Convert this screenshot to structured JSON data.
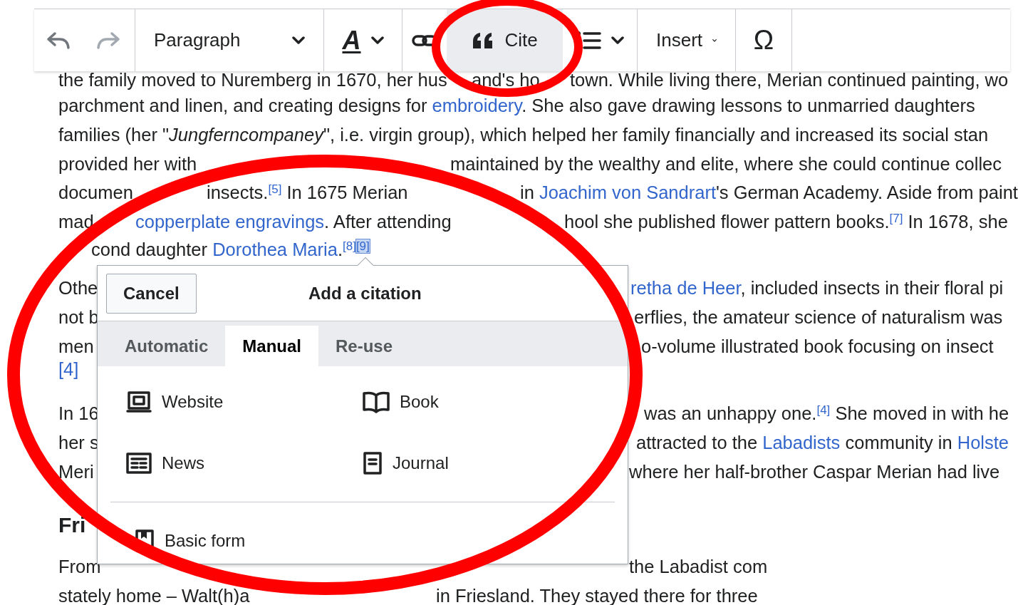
{
  "toolbar": {
    "items": [
      {
        "kind": "undo",
        "disabled": false,
        "highlighted": false
      },
      {
        "kind": "redo",
        "disabled": true,
        "highlighted": false
      },
      {
        "kind": "dropdown",
        "label": "Paragraph",
        "highlighted": false
      },
      {
        "kind": "text_style",
        "label": "A",
        "highlighted": false
      },
      {
        "kind": "link",
        "highlighted": false
      },
      {
        "kind": "cite",
        "label": "Cite",
        "highlighted": true
      },
      {
        "kind": "list",
        "highlighted": false
      },
      {
        "kind": "dropdown",
        "label": "Insert",
        "highlighted": false
      },
      {
        "kind": "char",
        "label": "Ω",
        "highlighted": false
      }
    ]
  },
  "article": {
    "lines": [
      {
        "pieces": [
          [
            {
              "kind": "text",
              "text": "the family moved to Nuremberg in 1670, her hus"
            }
          ],
          [
            {
              "kind": "text",
              "text": "and's ho"
            }
          ],
          [
            {
              "kind": "text",
              "text": "town. While living there, Merian continued painting, wo"
            }
          ]
        ]
      },
      {
        "pieces": [
          [
            {
              "kind": "text",
              "text": "parchment and linen, and creating designs for "
            },
            {
              "kind": "link",
              "text": "embroidery"
            },
            {
              "kind": "text",
              "text": ". She also gave drawing lessons to unmarried daughters"
            }
          ]
        ]
      },
      {
        "pieces": [
          [
            {
              "kind": "text",
              "text": "families (her \"*Jungferncompaney*\", i.e. virgin group), which helped her family financially and increased its social stan"
            }
          ]
        ]
      },
      {
        "pieces": [
          [
            {
              "kind": "text",
              "text": "provided her with"
            }
          ],
          [
            {
              "kind": "text",
              "text": "maintained by the wealthy and elite, where she could continue collec"
            }
          ]
        ]
      },
      {
        "pieces": [
          [
            {
              "kind": "text",
              "text": "documen"
            }
          ],
          [
            {
              "kind": "text",
              "text": "insects."
            },
            {
              "kind": "ref",
              "text": "[5]"
            },
            {
              "kind": "text",
              "text": " In 1675 Merian"
            }
          ],
          [
            {
              "kind": "text",
              "text": "in "
            },
            {
              "kind": "link",
              "text": "Joachim von Sandrart"
            },
            {
              "kind": "text",
              "text": "'s German Academy. Aside from paint"
            }
          ]
        ]
      },
      {
        "pieces": [
          [
            {
              "kind": "text",
              "text": "mad"
            }
          ],
          [
            {
              "kind": "link",
              "text": "copperplate engravings"
            },
            {
              "kind": "text",
              "text": ". After attending"
            }
          ],
          [
            {
              "kind": "text",
              "text": "hool she published flower pattern books."
            },
            {
              "kind": "ref",
              "text": "[7]"
            },
            {
              "kind": "text",
              "text": " In 1678, she"
            }
          ]
        ]
      },
      {
        "pieces": [
          [
            {
              "kind": "text",
              "text": "cond daughter "
            },
            {
              "kind": "link",
              "text": "Dorothea Maria"
            },
            {
              "kind": "text",
              "text": "."
            },
            {
              "kind": "ref",
              "text": "[8]"
            },
            {
              "kind": "ref_selected",
              "text": "[9]"
            }
          ]
        ]
      },
      {
        "pieces": [
          [
            {
              "kind": "text",
              "text": "Othe"
            }
          ],
          [
            {
              "kind": "link",
              "text": "retha de Heer"
            },
            {
              "kind": "text",
              "text": ", included insects in their floral pi"
            }
          ]
        ]
      },
      {
        "pieces": [
          [
            {
              "kind": "text",
              "text": "not b"
            }
          ],
          [
            {
              "kind": "text",
              "text": "erflies, the amateur science of naturalism was"
            }
          ]
        ]
      },
      {
        "pieces": [
          [
            {
              "kind": "text",
              "text": "men"
            }
          ],
          [
            {
              "kind": "text",
              "text": "o-volume illustrated book focusing on insect"
            }
          ]
        ]
      },
      {
        "pieces": [
          [
            {
              "kind": "ref",
              "text": "[4]"
            }
          ]
        ]
      },
      {
        "pieces": [
          [
            {
              "kind": "text",
              "text": "In 16"
            }
          ],
          [
            {
              "kind": "text",
              "text": "was an unhappy one."
            },
            {
              "kind": "ref",
              "text": "[4]"
            },
            {
              "kind": "text",
              "text": " She moved in with he"
            }
          ]
        ]
      },
      {
        "pieces": [
          [
            {
              "kind": "text",
              "text": "her s"
            }
          ],
          [
            {
              "kind": "text",
              "text": "attracted to the "
            },
            {
              "kind": "link",
              "text": "Labadists"
            },
            {
              "kind": "text",
              "text": " community in "
            },
            {
              "kind": "link",
              "text": "Holste"
            }
          ]
        ]
      },
      {
        "pieces": [
          [
            {
              "kind": "text",
              "text": "Meri"
            }
          ],
          [
            {
              "kind": "text",
              "text": "where her half-brother Caspar Merian had live"
            }
          ]
        ]
      },
      {
        "pieces": [
          [
            {
              "kind": "heading",
              "text": "Fri"
            }
          ]
        ]
      },
      {
        "pieces": [
          [
            {
              "kind": "text",
              "text": "From"
            }
          ],
          [
            {
              "kind": "text",
              "text": "the Labadist com"
            }
          ]
        ]
      },
      {
        "pieces": [
          [
            {
              "kind": "text",
              "text": "stately home – Walt(h)a"
            }
          ],
          [
            {
              "kind": "text",
              "text": "in Friesland. They stayed there for three"
            }
          ]
        ]
      }
    ]
  },
  "dialog": {
    "cancel": "Cancel",
    "title": "Add a citation",
    "tabs": [
      {
        "label": "Automatic",
        "selected": false
      },
      {
        "label": "Manual",
        "selected": true
      },
      {
        "label": "Re-use",
        "selected": false
      }
    ],
    "options": [
      {
        "kind": "website",
        "label": "Website"
      },
      {
        "kind": "book",
        "label": "Book"
      },
      {
        "kind": "news",
        "label": "News"
      },
      {
        "kind": "journal",
        "label": "Journal"
      }
    ],
    "basic": {
      "kind": "basic_form",
      "label": "Basic form"
    }
  }
}
